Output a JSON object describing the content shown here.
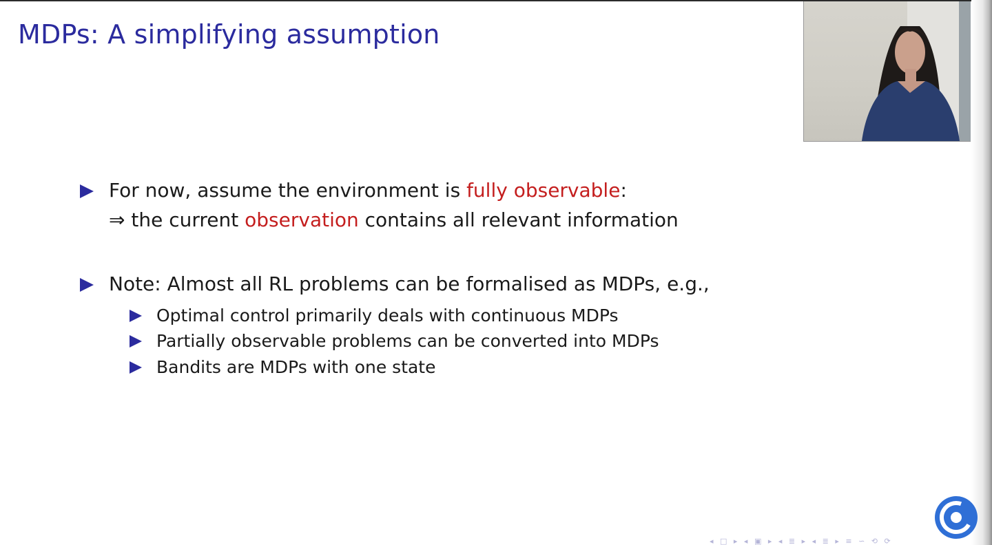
{
  "slide": {
    "title": "MDPs: A simplifying assumption",
    "bullets": [
      {
        "pre": "For now, assume the environment is ",
        "highlight": "fully observable",
        "post": ":",
        "line2_arrow": "⇒",
        "line2_pre": " the current ",
        "line2_highlight": "observation",
        "line2_post": " contains all relevant information"
      },
      {
        "text": "Note: Almost all RL problems can be formalised as MDPs, e.g.,",
        "subitems": [
          "Optimal control primarily deals with continuous MDPs",
          "Partially observable problems can be converted into MDPs",
          "Bandits are MDPs with one state"
        ]
      }
    ]
  },
  "icons": {
    "bullet": "triangle-right-icon",
    "logo": "deepmind-logo-icon"
  },
  "colors": {
    "title": "#2b2b9e",
    "bullet": "#2b2b9e",
    "highlight": "#c41e1e",
    "text": "#1a1a1a",
    "logo": "#2f6fd6"
  }
}
